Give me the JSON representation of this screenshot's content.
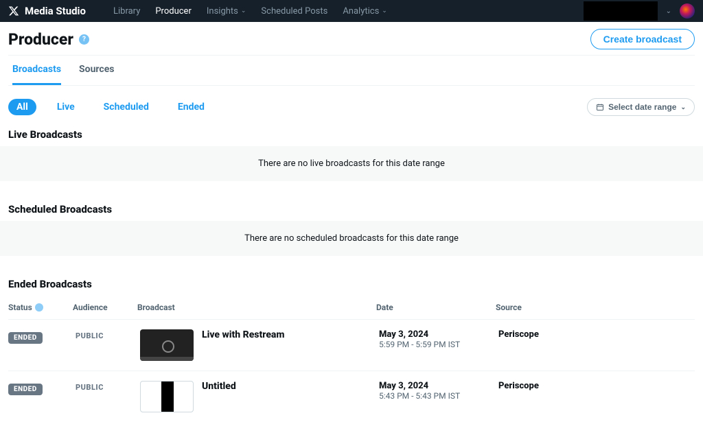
{
  "brand": "Media Studio",
  "nav": {
    "library": "Library",
    "producer": "Producer",
    "insights": "Insights",
    "scheduled": "Scheduled Posts",
    "analytics": "Analytics"
  },
  "page": {
    "title": "Producer",
    "create_btn": "Create broadcast"
  },
  "tabs": {
    "broadcasts": "Broadcasts",
    "sources": "Sources"
  },
  "filters": {
    "all": "All",
    "live": "Live",
    "scheduled": "Scheduled",
    "ended": "Ended",
    "date_range": "Select date range"
  },
  "sections": {
    "live_title": "Live Broadcasts",
    "live_empty": "There are no live broadcasts for this date range",
    "scheduled_title": "Scheduled Broadcasts",
    "scheduled_empty": "There are no scheduled broadcasts for this date range",
    "ended_title": "Ended Broadcasts"
  },
  "columns": {
    "status": "Status",
    "audience": "Audience",
    "broadcast": "Broadcast",
    "date": "Date",
    "source": "Source"
  },
  "rows": [
    {
      "status": "ENDED",
      "audience": "PUBLIC",
      "title": "Live with Restream",
      "date": "May 3, 2024",
      "time": "5:59 PM - 5:59 PM IST",
      "source": "Periscope"
    },
    {
      "status": "ENDED",
      "audience": "PUBLIC",
      "title": "Untitled",
      "date": "May 3, 2024",
      "time": "5:43 PM - 5:43 PM IST",
      "source": "Periscope"
    }
  ]
}
